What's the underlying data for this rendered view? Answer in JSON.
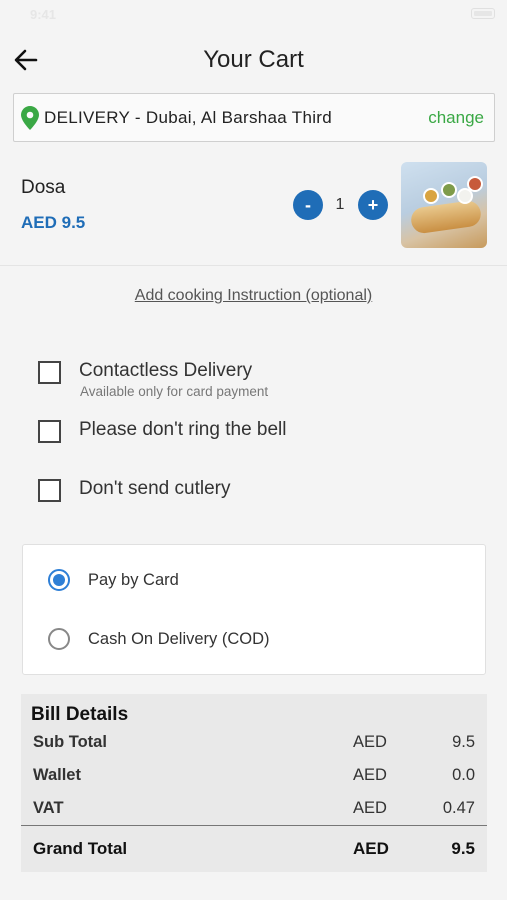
{
  "status_bar": {
    "time": "9:41"
  },
  "header": {
    "title": "Your Cart"
  },
  "delivery": {
    "label": "DELIVERY  -  Dubai, Al Barshaa Third",
    "change_label": "change",
    "pin_color": "#3aa845"
  },
  "cart": {
    "items": [
      {
        "name": "Dosa",
        "price": "AED 9.5",
        "quantity": "1",
        "minus_label": "-",
        "plus_label": "+"
      }
    ]
  },
  "cooking_instruction": "Add cooking Instruction (optional)",
  "options": [
    {
      "label": "Contactless Delivery",
      "sublabel": "Available only for card payment",
      "checked": false
    },
    {
      "label": "Please don't ring the bell",
      "checked": false
    },
    {
      "label": "Don't send cutlery",
      "checked": false
    }
  ],
  "payment": {
    "methods": [
      {
        "label": "Pay by Card",
        "selected": true
      },
      {
        "label": "Cash On Delivery (COD)",
        "selected": false
      }
    ]
  },
  "bill": {
    "title": "Bill Details",
    "rows": [
      {
        "label": "Sub Total",
        "currency": "AED",
        "value": "9.5"
      },
      {
        "label": "Wallet",
        "currency": "AED",
        "value": "0.0"
      },
      {
        "label": "VAT",
        "currency": "AED",
        "value": "0.47"
      }
    ],
    "grand_total": {
      "label": "Grand Total",
      "currency": "AED",
      "value": "9.5"
    }
  },
  "colors": {
    "accent_blue": "#1f6db7",
    "radio_blue": "#2e7fd6",
    "change_green": "#3aa845"
  }
}
